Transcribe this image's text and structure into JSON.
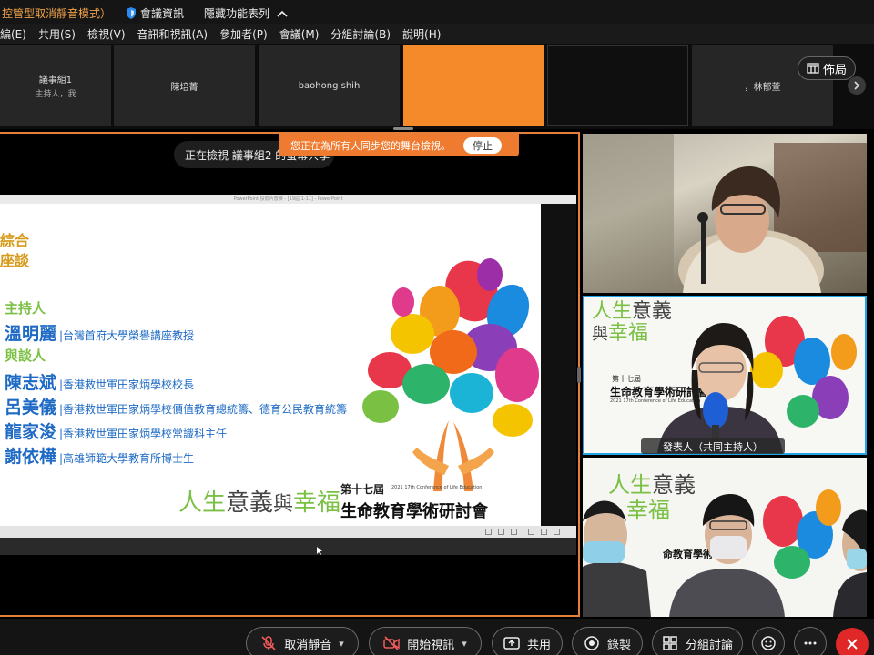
{
  "topbar": {
    "status_text": "控管型取消靜音模式）",
    "meeting_info": "會議資訊",
    "hidden_features": "隱藏功能表列"
  },
  "menu": [
    "編(E)",
    "共用(S)",
    "檢視(V)",
    "音訊和視訊(A)",
    "參加者(P)",
    "會議(M)",
    "分組討論(B)",
    "說明(H)"
  ],
  "thumbnails": [
    {
      "name": "議事組1",
      "role": "主持人，我"
    },
    {
      "name": "陳培菁",
      "role": ""
    },
    {
      "name": "baohong shih",
      "role": ""
    },
    {
      "name": "",
      "role": ""
    },
    {
      "name": "",
      "role": ""
    },
    {
      "name": "，林郁萱",
      "role": ""
    }
  ],
  "layout_label": "佈局",
  "viewing_text": "正在檢視 議事組2 的螢幕共享",
  "sync_bar": {
    "message": "您正在為所有人同步您的舞台檢視。",
    "stop_label": "停止"
  },
  "ppt_window_title": "PowerPoint 投影片放映 - [19屆 1-11] - PowerPoint",
  "slide": {
    "heading_line1": "綜合",
    "heading_line2": "座談",
    "host_label": "主持人",
    "host": {
      "name": "溫明麗",
      "title": "|台灣首府大學榮譽講座教授"
    },
    "panel_label": "與談人",
    "panelists": [
      {
        "name": "陳志斌",
        "title": "|香港救世軍田家炳學校校長"
      },
      {
        "name": "呂美儀",
        "title": "|香港救世軍田家炳學校價值教育總統籌、德育公民教育統籌"
      },
      {
        "name": "龍家浚",
        "title": "|香港救世軍田家炳學校常識科主任"
      },
      {
        "name": "謝依樺",
        "title": "|高雄師範大學教育所博士生"
      }
    ],
    "logo_text_a": "人生",
    "logo_text_b": "意義",
    "logo_text_c": "與",
    "logo_text_d": "幸福",
    "conf_edition": "第十七屆",
    "conf_english": "2021 17th Conference of Life Education",
    "conf_name": "生命教育學術研討會"
  },
  "video2": {
    "banner_a": "人生",
    "banner_b": "意義",
    "banner_c": "與",
    "banner_d": "幸福",
    "conf_small": "第十七屆",
    "conf_name": "生命教育學術研討會",
    "conf_english": "2021 17th Conference of Life Education",
    "caption": "發表人（共同主持人）"
  },
  "video3": {
    "banner_a": "人生",
    "banner_b": "意義",
    "banner_c": "幸福",
    "conf_name": "命教育學術研討會"
  },
  "toolbar": {
    "mute_label": "取消靜音",
    "video_label": "開始視訊",
    "share_label": "共用",
    "record_label": "錄製",
    "breakout_label": "分組討論"
  },
  "colors": {
    "accent_orange": "#ee7b2f",
    "active_speaker_blue": "#23a3e8",
    "leave_red": "#e02828"
  }
}
